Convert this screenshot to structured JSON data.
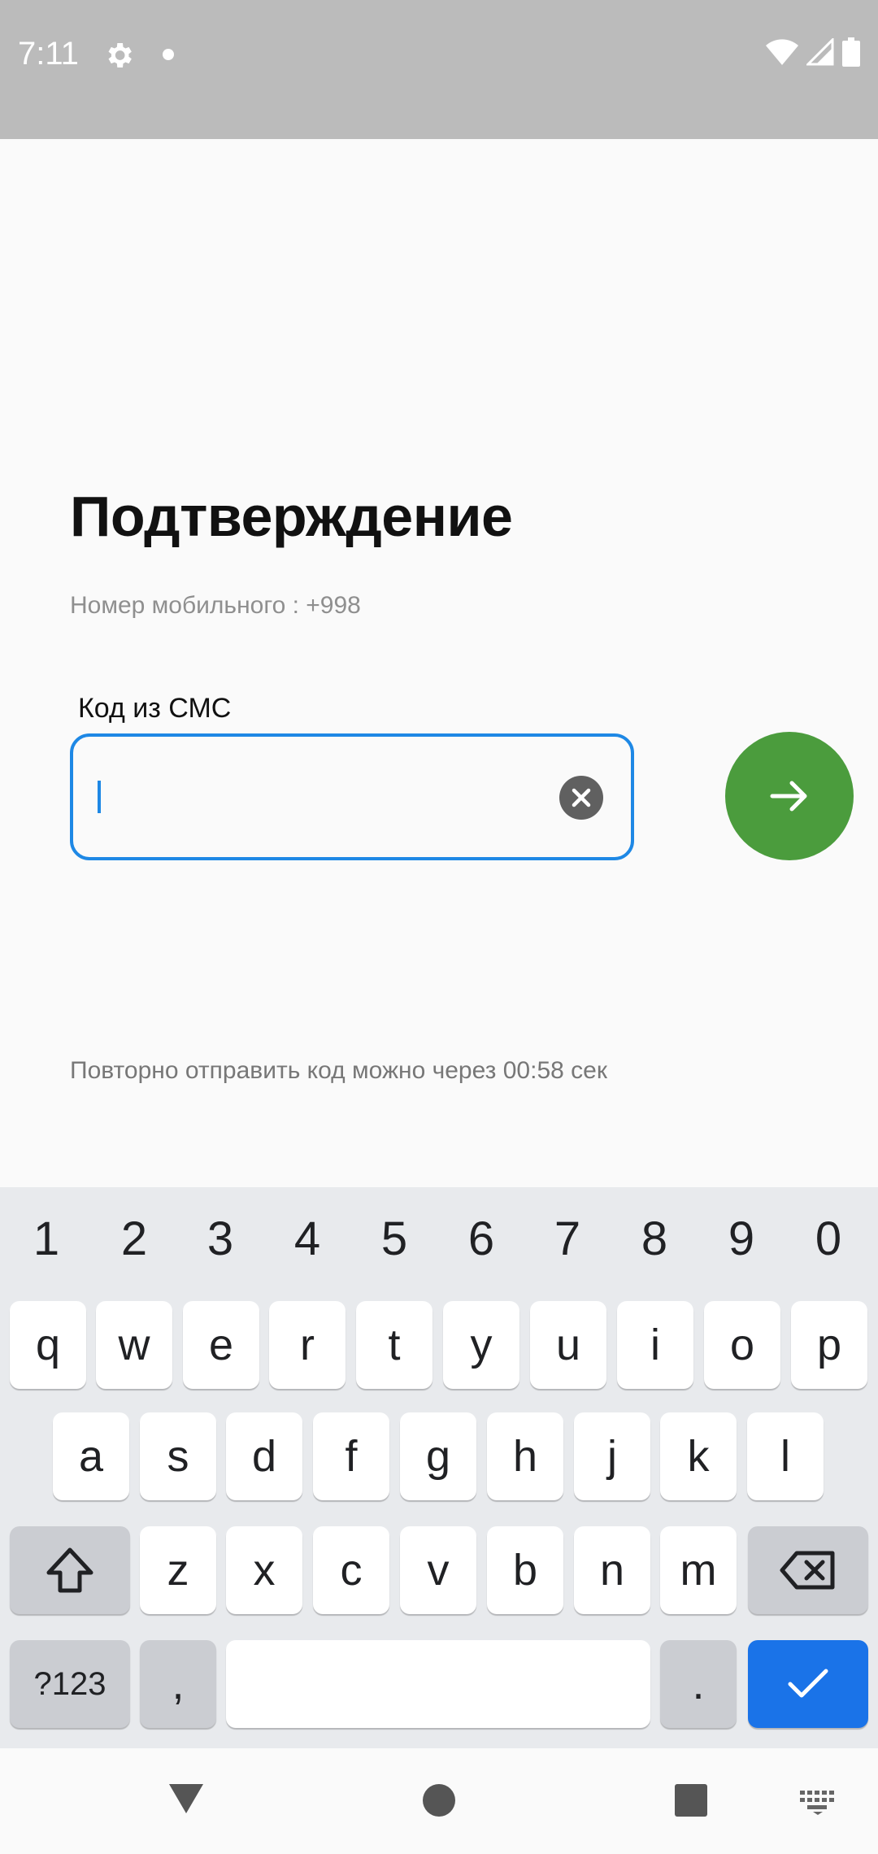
{
  "status_bar": {
    "time": "7:11"
  },
  "screen": {
    "title": "Подтверждение",
    "phone_label": "Номер мобильного : +998",
    "code_label": "Код из СМС",
    "code_value": "",
    "resend_text": "Повторно отправить код можно через 00:58 сек"
  },
  "keyboard": {
    "numbers": [
      "1",
      "2",
      "3",
      "4",
      "5",
      "6",
      "7",
      "8",
      "9",
      "0"
    ],
    "row1": [
      "q",
      "w",
      "e",
      "r",
      "t",
      "y",
      "u",
      "i",
      "o",
      "p"
    ],
    "row2": [
      "a",
      "s",
      "d",
      "f",
      "g",
      "h",
      "j",
      "k",
      "l"
    ],
    "row3": [
      "z",
      "x",
      "c",
      "v",
      "b",
      "n",
      "m"
    ],
    "symbols_label": "?123",
    "comma": ",",
    "period": "."
  },
  "colors": {
    "accent_blue": "#1e88e5",
    "submit_green": "#4b9c3d",
    "enter_blue": "#1a73e8",
    "status_bar": "#bbbbbb"
  },
  "icons": [
    "gear-icon",
    "wifi-icon",
    "signal-icon",
    "battery-icon",
    "clear-icon",
    "arrow-right-icon",
    "shift-icon",
    "backspace-icon",
    "check-icon",
    "back-icon",
    "home-icon",
    "recents-icon",
    "keyboard-icon"
  ]
}
